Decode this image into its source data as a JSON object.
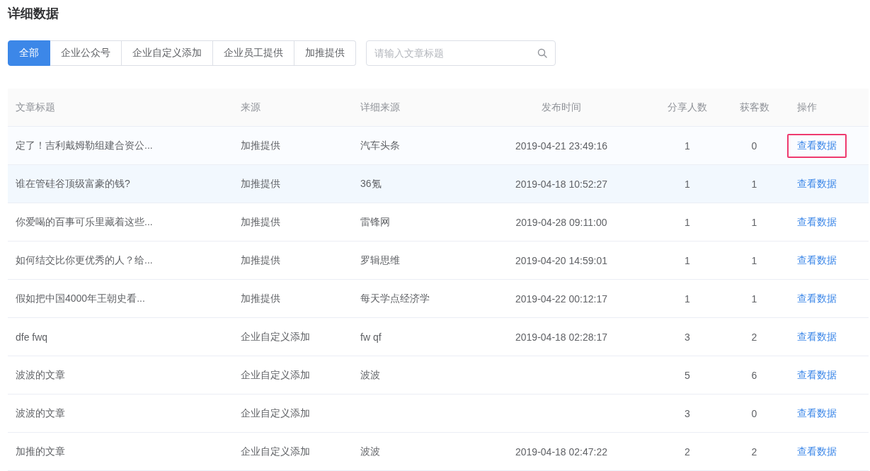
{
  "page_title": "详细数据",
  "filter_tabs": [
    {
      "label": "全部",
      "selected": true
    },
    {
      "label": "企业公众号",
      "selected": false
    },
    {
      "label": "企业自定义添加",
      "selected": false
    },
    {
      "label": "企业员工提供",
      "selected": false
    },
    {
      "label": "加推提供",
      "selected": false
    }
  ],
  "search": {
    "placeholder": "请输入文章标题"
  },
  "table": {
    "columns": [
      "文章标题",
      "来源",
      "详细来源",
      "发布时间",
      "分享人数",
      "获客数",
      "操作"
    ],
    "rows": [
      {
        "title": "定了！吉利戴姆勒组建合资公...",
        "source": "加推提供",
        "detail_source": "汽车头条",
        "published": "2019-04-21 23:49:16",
        "shares": "1",
        "customers": "0",
        "action": "查看数据",
        "hovered": false,
        "annotated": true
      },
      {
        "title": "谁在管硅谷顶级富豪的钱?",
        "source": "加推提供",
        "detail_source": "36氪",
        "published": "2019-04-18 10:52:27",
        "shares": "1",
        "customers": "1",
        "action": "查看数据",
        "hovered": true,
        "annotated": false
      },
      {
        "title": "你爱喝的百事可乐里藏着这些...",
        "source": "加推提供",
        "detail_source": "雷锋网",
        "published": "2019-04-28 09:11:00",
        "shares": "1",
        "customers": "1",
        "action": "查看数据",
        "hovered": false,
        "annotated": false
      },
      {
        "title": "如何结交比你更优秀的人？给...",
        "source": "加推提供",
        "detail_source": "罗辑思维",
        "published": "2019-04-20 14:59:01",
        "shares": "1",
        "customers": "1",
        "action": "查看数据",
        "hovered": false,
        "annotated": false
      },
      {
        "title": "假如把中国4000年王朝史看...",
        "source": "加推提供",
        "detail_source": "每天学点经济学",
        "published": "2019-04-22 00:12:17",
        "shares": "1",
        "customers": "1",
        "action": "查看数据",
        "hovered": false,
        "annotated": false
      },
      {
        "title": "dfe fwq",
        "source": "企业自定义添加",
        "detail_source": "fw qf",
        "published": "2019-04-18 02:28:17",
        "shares": "3",
        "customers": "2",
        "action": "查看数据",
        "hovered": false,
        "annotated": false
      },
      {
        "title": "波波的文章",
        "source": "企业自定义添加",
        "detail_source": "波波",
        "shares": "5",
        "customers": "6",
        "action": "查看数据",
        "hovered": false,
        "annotated": false
      },
      {
        "title": "波波的文章",
        "source": "企业自定义添加",
        "shares": "3",
        "customers": "0",
        "action": "查看数据",
        "hovered": false,
        "annotated": false
      },
      {
        "title": "加推的文章",
        "source": "企业自定义添加",
        "detail_source": "波波",
        "published": "2019-04-18 02:47:22",
        "shares": "2",
        "customers": "2",
        "action": "查看数据",
        "hovered": false,
        "annotated": false
      }
    ]
  }
}
